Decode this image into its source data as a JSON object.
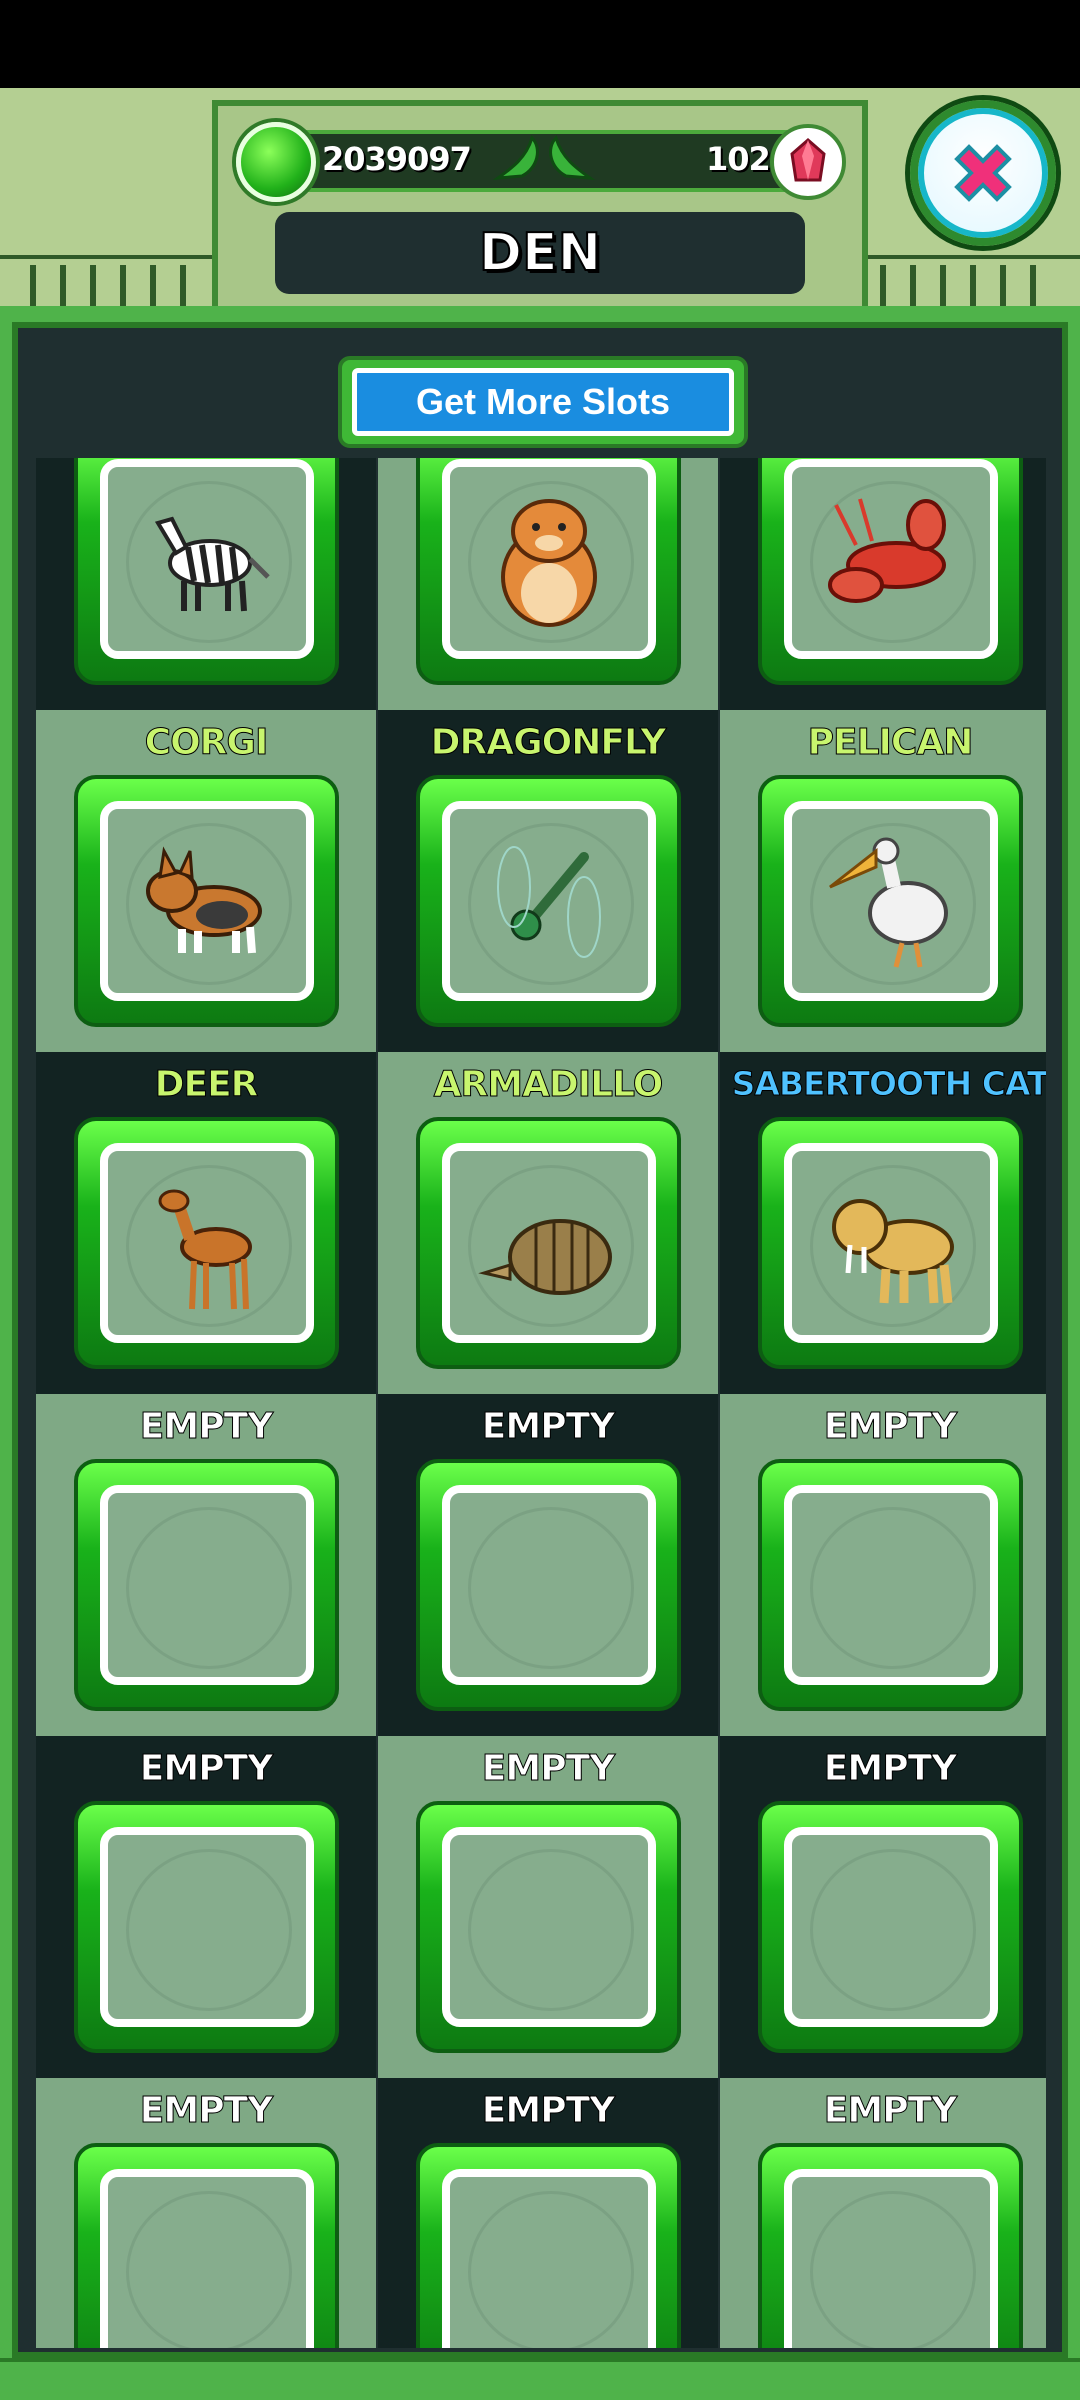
{
  "header": {
    "coins": "2039097",
    "gems": "102",
    "title": "DEN"
  },
  "get_more_slots": "Get More Slots",
  "colors": {
    "light_name": "#c8f56e",
    "blue_name": "#4fc2ff",
    "empty_name": "#ffffff",
    "frame_green": "#19b21a",
    "panel_green": "#4fb34a"
  },
  "slots": [
    {
      "name": "",
      "animal": "zebra"
    },
    {
      "name": "",
      "animal": "hamster"
    },
    {
      "name": "",
      "animal": "lobster"
    },
    {
      "name": "CORGI",
      "animal": "corgi"
    },
    {
      "name": "DRAGONFLY",
      "animal": "dragonfly"
    },
    {
      "name": "PELICAN",
      "animal": "pelican"
    },
    {
      "name": "DEER",
      "animal": "deer"
    },
    {
      "name": "ARMADILLO",
      "animal": "armadillo"
    },
    {
      "name": "SABERTOOTH CAT",
      "animal": "sabertooth-cat"
    },
    {
      "name": "EMPTY",
      "animal": ""
    },
    {
      "name": "EMPTY",
      "animal": ""
    },
    {
      "name": "EMPTY",
      "animal": ""
    },
    {
      "name": "EMPTY",
      "animal": ""
    },
    {
      "name": "EMPTY",
      "animal": ""
    },
    {
      "name": "EMPTY",
      "animal": ""
    },
    {
      "name": "EMPTY",
      "animal": ""
    },
    {
      "name": "EMPTY",
      "animal": ""
    },
    {
      "name": "EMPTY",
      "animal": ""
    }
  ]
}
